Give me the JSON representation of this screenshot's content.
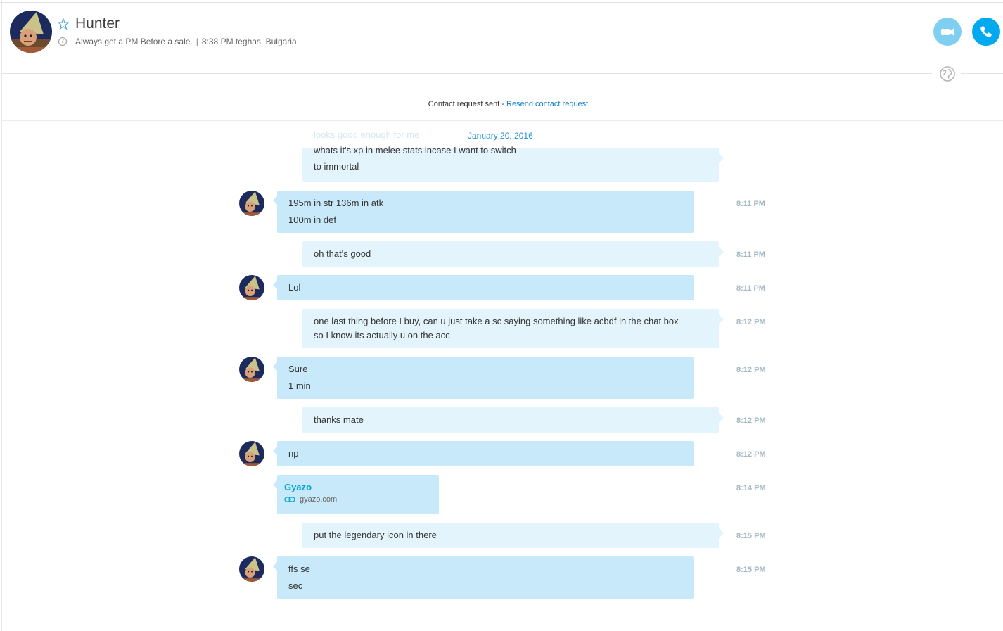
{
  "contact": {
    "name": "Hunter",
    "mood": "Always get a PM Before a sale.",
    "separator": "|",
    "local_time_location": "8:38 PM teghas, Bulgaria"
  },
  "icons": {
    "favorite": "star-outline-icon",
    "mood": "question-circle-icon",
    "video": "video-camera-icon",
    "call": "phone-icon",
    "globe": "globe-icon",
    "link": "link-icon"
  },
  "colors": {
    "accent": "#00a9f0",
    "video_button": "#7fd0f0",
    "incoming_bubble": "#c7e9f9",
    "outgoing_bubble": "#e4f4fc",
    "link": "#0f7fcc",
    "timestamp": "#a4b7c4"
  },
  "contact_request": {
    "status": "Contact request sent - ",
    "action": "Resend contact request"
  },
  "conversation": {
    "date_separator": "January 20, 2016",
    "faded_previous_message": "looks good enough for me",
    "messages": [
      {
        "direction": "out",
        "lines": [
          "whats it's xp in melee stats incase I want to switch",
          "to immortal"
        ],
        "time": ""
      },
      {
        "direction": "in",
        "lines": [
          "195m in str 136m in atk",
          "100m in def"
        ],
        "time": "8:11 PM"
      },
      {
        "direction": "out",
        "lines": [
          "oh that's good"
        ],
        "time": "8:11 PM"
      },
      {
        "direction": "in",
        "lines": [
          "Lol"
        ],
        "time": "8:11 PM"
      },
      {
        "direction": "out",
        "lines": [
          "one last thing before I buy, can u just take a sc saying something like acbdf in the chat box",
          "so I know its actually u on the acc"
        ],
        "time": "8:12 PM"
      },
      {
        "direction": "in",
        "lines": [
          "Sure",
          "1 min"
        ],
        "time": "8:12 PM"
      },
      {
        "direction": "out",
        "lines": [
          "thanks mate"
        ],
        "time": "8:12 PM"
      },
      {
        "direction": "in",
        "lines": [
          "np"
        ],
        "time": "8:12 PM"
      },
      {
        "direction": "in",
        "type": "link",
        "title": "Gyazo",
        "url": "gyazo.com",
        "time": "8:14 PM"
      },
      {
        "direction": "out",
        "lines": [
          "put the legendary icon in there"
        ],
        "time": "8:15 PM"
      },
      {
        "direction": "in",
        "lines": [
          "ffs se",
          "sec"
        ],
        "time": "8:15 PM"
      }
    ]
  }
}
